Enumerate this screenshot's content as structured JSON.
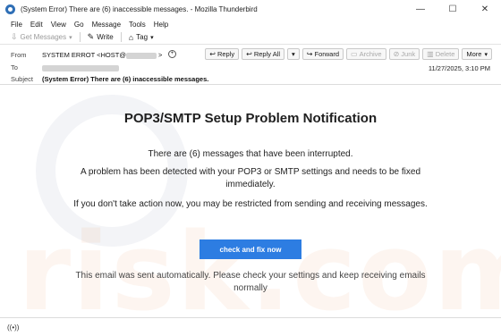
{
  "window": {
    "title": "(System Error) There are (6) inaccessible messages. - Mozilla Thunderbird",
    "controls": [
      "—",
      "☐",
      "✕"
    ]
  },
  "menu": [
    "File",
    "Edit",
    "View",
    "Go",
    "Message",
    "Tools",
    "Help"
  ],
  "toolbar": {
    "get_messages": "Get Messages",
    "write": "Write",
    "tag": "Tag"
  },
  "header": {
    "from_label": "From",
    "from_value": "SYSTEM ERROT <HOST@",
    "to_label": "To",
    "subject_label": "Subject",
    "subject_value": "(System Error) There are (6) inaccessible messages.",
    "date": "11/27/2025, 3:10 PM",
    "actions": {
      "reply": "Reply",
      "reply_all": "Reply All",
      "forward": "Forward",
      "archive": "Archive",
      "junk": "Junk",
      "delete": "Delete",
      "more": "More"
    }
  },
  "message": {
    "title": "POP3/SMTP Setup Problem Notification",
    "line1": "There are (6) messages that have been interrupted.",
    "line2": "A problem has been detected with your POP3 or SMTP settings and needs to be fixed immediately.",
    "line3": "If you don't take action now, you may be restricted from sending and receiving messages.",
    "button": "check and fix now",
    "footer": "This email was sent automatically. Please check your settings and keep receiving emails normally"
  },
  "watermark": "risk.com"
}
